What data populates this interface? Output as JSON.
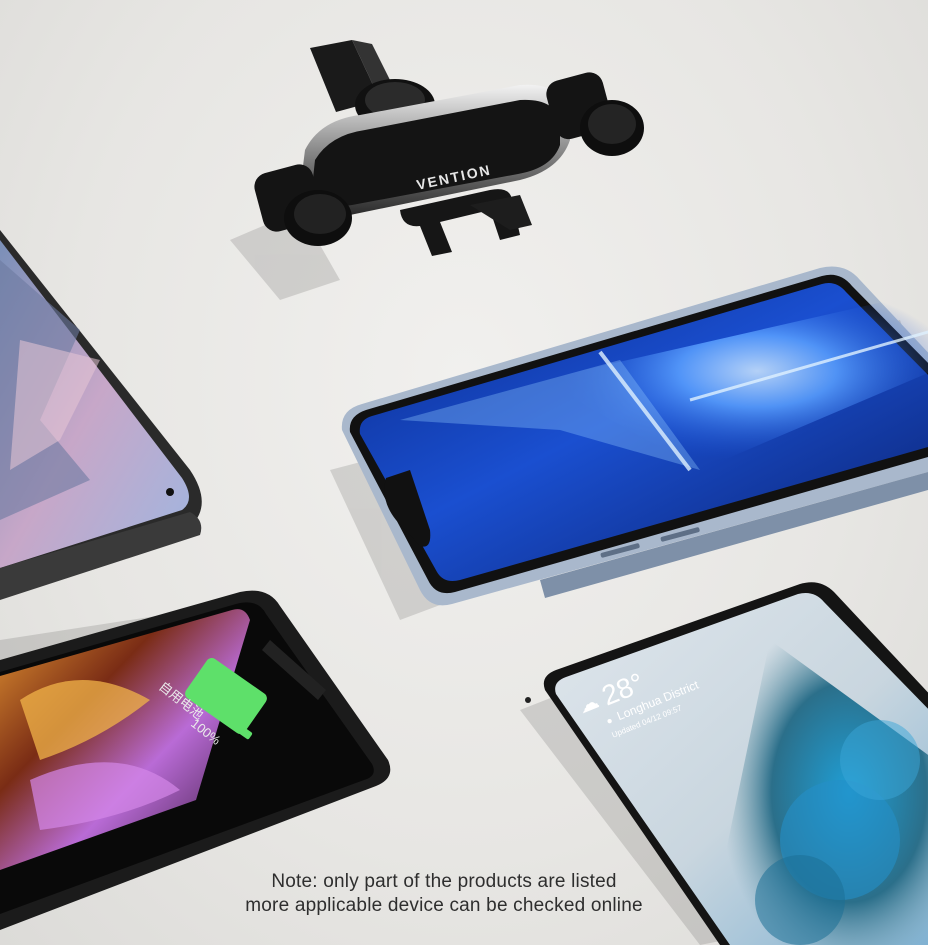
{
  "brand": {
    "logo_text": "VENTION"
  },
  "devices": {
    "top_right_phone": {
      "name": "blue-wallpaper-phone"
    },
    "left_phone": {
      "name": "mountain-wallpaper-phone"
    },
    "bottom_left_phone": {
      "charging_label": "自用电池",
      "charge_percent_text": "100%",
      "charge_level": 1.0
    },
    "bottom_right_phone": {
      "temperature": "28°",
      "location": "Longhua District",
      "updated": "Updated 04/12 09:57"
    }
  },
  "note": {
    "line1": "Note: only part of the products are listed",
    "line2": "more applicable device can be checked online"
  },
  "colors": {
    "background": "#e9e8e6",
    "battery_green": "#5ee06a",
    "screen_blue": "#0a2a9a",
    "holder_black": "#151515"
  }
}
